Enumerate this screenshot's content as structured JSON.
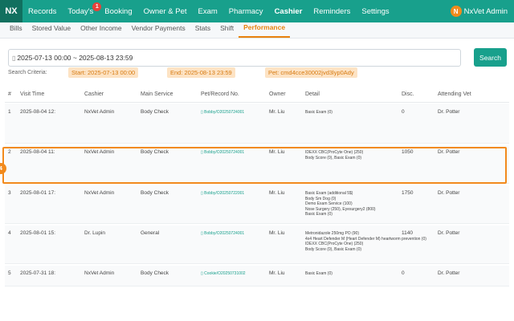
{
  "brand": {
    "logo": "NX",
    "accent": "#18a08c",
    "highlight": "#f28a1c"
  },
  "nav": {
    "items": [
      "Records",
      "Today's",
      "Booking",
      "Owner & Pet",
      "Exam",
      "Pharmacy",
      "Cashier",
      "Reminders",
      "Settings"
    ],
    "active": "Cashier",
    "todays_badge": "1",
    "user_initial": "N",
    "user_name": "NxVet Admin"
  },
  "subnav": {
    "items": [
      "Bills",
      "Stored Value",
      "Other Income",
      "Vendor Payments",
      "Stats",
      "Shift",
      "Performance"
    ],
    "active": "Performance"
  },
  "filter": {
    "date_range": "2025-07-13 00:00 ~ 2025-08-13 23:59",
    "search_label": "Search",
    "criteria_label": "Search Criteria:",
    "chips": [
      "Start: 2025-07-13 00:00",
      "End: 2025-08-13 23:59",
      "Pet: cmd4cce30002jvd3lyp0Ady"
    ]
  },
  "table": {
    "columns": [
      "#",
      "Visit Time",
      "Cashier",
      "Main Service",
      "Pet/Record No.",
      "Owner",
      "Detail",
      "Disc.",
      "Attending Vet"
    ],
    "rows": [
      {
        "num": "1",
        "time": "2025-08-04 12:",
        "cashier": "NxVet Admin",
        "service": "Body Check",
        "pet": "Bobby/O20250724001",
        "owner": "Mr. Liu",
        "detail": [
          "Basic Exam (0)"
        ],
        "disc": "0",
        "vet": "Dr. Potter"
      },
      {
        "num": "2",
        "time": "2025-08-04 11:",
        "cashier": "NxVet Admin",
        "service": "Body Check",
        "pet": "Bobby/O20250724001",
        "owner": "Mr. Liu",
        "detail": [
          "IDEXX CBC(ProCyte One) (250)",
          "Body Score (0), Basic Exam (0)"
        ],
        "disc": "1050",
        "vet": "Dr. Potter"
      },
      {
        "num": "3",
        "time": "2025-08-01 17:",
        "cashier": "NxVet Admin",
        "service": "Body Check",
        "pet": "Bobby/O20250722001",
        "owner": "Mr. Liu",
        "detail": [
          "Basic Exam (additional 5$)",
          "Body Sm Dog (0)",
          "Demo Exam Service (100)",
          "Nose Surgery (250), Eyesurgery2 (800)",
          "Basic Exam (0)"
        ],
        "disc": "1750",
        "vet": "Dr. Potter"
      },
      {
        "num": "4",
        "time": "2025-08-01 15:",
        "cashier": "Dr. Lupin",
        "service": "General",
        "pet": "Bobby/O20250724001",
        "owner": "Mr. Liu",
        "detail": [
          "Metronidazole 250mg PO (90)",
          "4x4 Heart Defender M (Heart Defender M) heartworm prevention (0)",
          "IDEXX CBC(ProCyte One) (250)",
          "Body Score (0), Basic Exam (0)"
        ],
        "disc": "1140",
        "vet": "Dr. Potter"
      },
      {
        "num": "5",
        "time": "2025-07-31 18:",
        "cashier": "NxVet Admin",
        "service": "Body Check",
        "pet": "Cookie/O20250731002",
        "owner": "Mr. Liu",
        "detail": [
          "Basic Exam (0)"
        ],
        "disc": "0",
        "vet": "Dr. Potter"
      }
    ],
    "highlighted_row": "2",
    "marker_label": "4"
  }
}
